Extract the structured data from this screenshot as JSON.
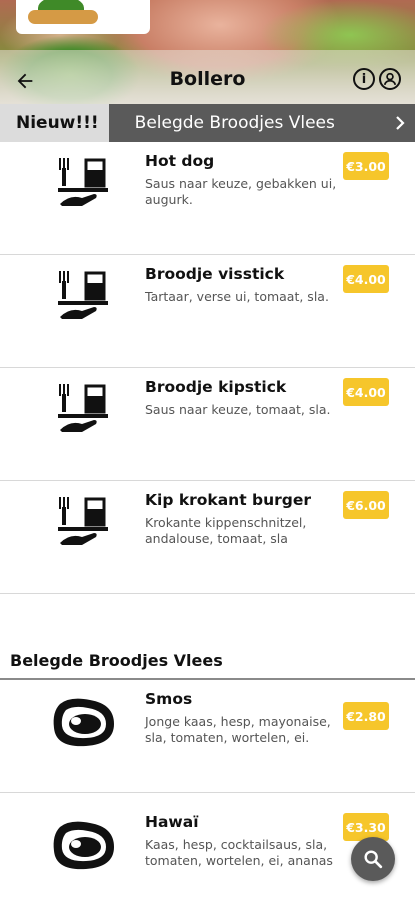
{
  "header": {
    "title": "Bollero",
    "back_icon": "arrow-left-icon",
    "info_icon": "info-icon",
    "account_icon": "account-icon"
  },
  "categories": {
    "active": "Nieuw!!!",
    "next": "Belegde Broodjes Vlees"
  },
  "items_top": [
    {
      "name": "Hot dog",
      "desc": "Saus naar keuze, gebakken ui, augurk.",
      "price": "€3.00",
      "icon": "dining-icon"
    },
    {
      "name": "Broodje visstick",
      "desc": "Tartaar, verse ui, tomaat, sla.",
      "price": "€4.00",
      "icon": "dining-icon"
    },
    {
      "name": "Broodje kipstick",
      "desc": "Saus naar keuze, tomaat, sla.",
      "price": "€4.00",
      "icon": "dining-icon"
    },
    {
      "name": "Kip krokant burger",
      "desc": "Krokante kippenschnitzel, andalouse, tomaat, sla",
      "price": "€6.00",
      "icon": "dining-icon"
    }
  ],
  "section": {
    "title": "Belegde Broodjes Vlees"
  },
  "items_meat": [
    {
      "name": "Smos",
      "desc": "Jonge kaas, hesp, mayonaise, sla, tomaten, wortelen, ei.",
      "price": "€2.80",
      "icon": "meat-icon"
    },
    {
      "name": "Hawaï",
      "desc": "Kaas, hesp, cocktailsaus, sla, tomaten, wortelen, ei, ananas",
      "price": "€3.30",
      "icon": "meat-icon"
    }
  ],
  "colors": {
    "price_badge": "#f6c62b",
    "category_bar": "#5a5a5a",
    "active_tab": "#dcdcdc"
  },
  "fab_icon": "search-icon"
}
